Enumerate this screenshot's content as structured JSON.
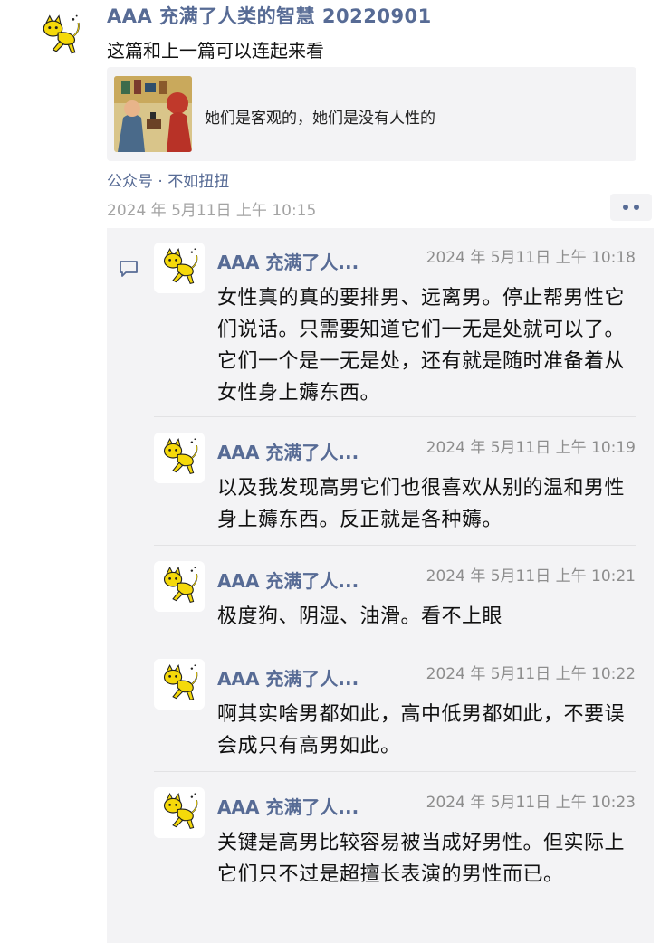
{
  "post": {
    "author": "AAA 充满了人类的智慧 20220901",
    "text": "这篇和上一篇可以连起来看",
    "avatar_icon": "yellow-cat-icon",
    "share": {
      "title": "她们是客观的，她们是没有人性的",
      "thumbnail_icon": "illustration-thumbnail"
    },
    "source": "公众号 · 不如扭扭",
    "time": "2024 年 5月11日  上午 10:15"
  },
  "comments": [
    {
      "author": "AAA 充满了人...",
      "time": "2024 年 5月11日  上午 10:18",
      "text": "女性真的真的要排男、远离男。停止帮男性它们说话。只需要知道它们一无是处就可以了。它们一个是一无是处，还有就是随时准备着从女性身上薅东西。"
    },
    {
      "author": "AAA 充满了人...",
      "time": "2024 年 5月11日  上午 10:19",
      "text": "以及我发现高男它们也很喜欢从别的温和男性身上薅东西。反正就是各种薅。"
    },
    {
      "author": "AAA 充满了人...",
      "time": "2024 年 5月11日  上午 10:21",
      "text": "极度狗、阴湿、油滑。看不上眼"
    },
    {
      "author": "AAA 充满了人...",
      "time": "2024 年 5月11日  上午 10:22",
      "text": "啊其实啥男都如此，高中低男都如此，不要误会成只有高男如此。"
    },
    {
      "author": "AAA 充满了人...",
      "time": "2024 年 5月11日  上午 10:23",
      "text": "关键是高男比较容易被当成好男性。但实际上它们只不过是超擅长表演的男性而已。"
    }
  ],
  "colors": {
    "link": "#576b95",
    "time": "#a3a3a3",
    "panel": "#f3f3f5",
    "avatar_yellow": "#f5d90a"
  }
}
